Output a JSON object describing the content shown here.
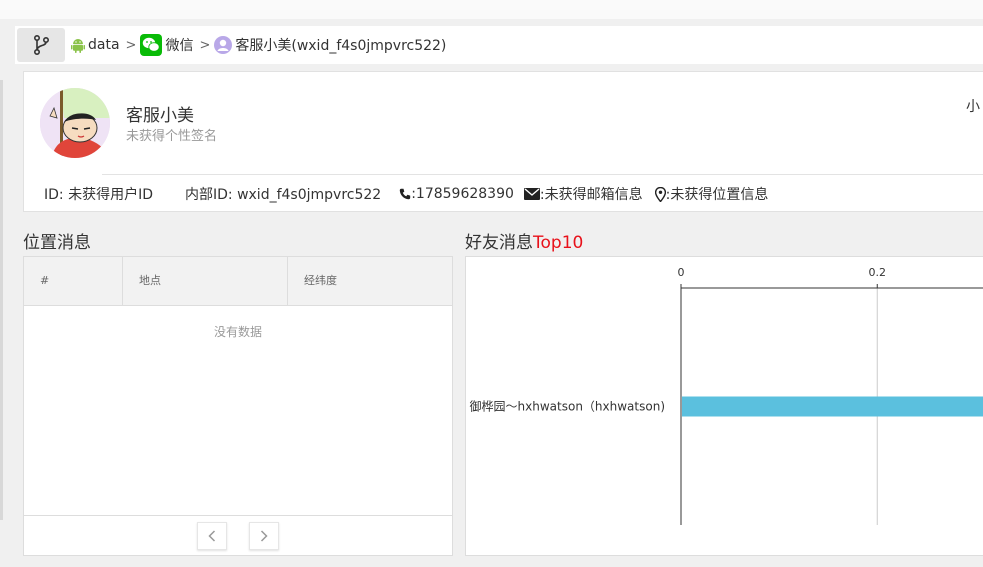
{
  "breadcrumb": {
    "items": [
      {
        "label": "data",
        "icon": "android-icon"
      },
      {
        "label": "微信",
        "icon": "wechat-icon"
      },
      {
        "label": "客服小美(wxid_f4s0jmpvrc522)",
        "icon": "user-avatar-icon"
      }
    ]
  },
  "profile": {
    "name": "客服小美",
    "signature": "未获得个性签名",
    "right_text": "小",
    "id": "ID: 未获得用户ID",
    "internal_id": "内部ID: wxid_f4s0jmpvrc522",
    "phone": ":17859628390",
    "email": ":未获得邮箱信息",
    "location": ":未获得位置信息"
  },
  "location_section": {
    "title": "位置消息",
    "columns": [
      "#",
      "地点",
      "经纬度"
    ],
    "empty_text": "没有数据",
    "prev_icon": "chevron-left-icon",
    "next_icon": "chevron-right-icon"
  },
  "friends_section": {
    "title": "好友消息",
    "title_highlight": "Top10"
  },
  "chart_data": {
    "type": "bar",
    "orientation": "horizontal",
    "categories": [
      "御桦园～hxhwatson（hxhwatson)"
    ],
    "values": [
      0.4
    ],
    "xticks": [
      "0",
      "0.2"
    ],
    "xlim": [
      0,
      0.4
    ],
    "grid": true,
    "bar_color": "#5bc0de"
  },
  "colors": {
    "accent_red": "#e8111a",
    "wechat_green": "#09bb07",
    "android_green": "#8bc34a",
    "bar": "#5bc0de"
  }
}
